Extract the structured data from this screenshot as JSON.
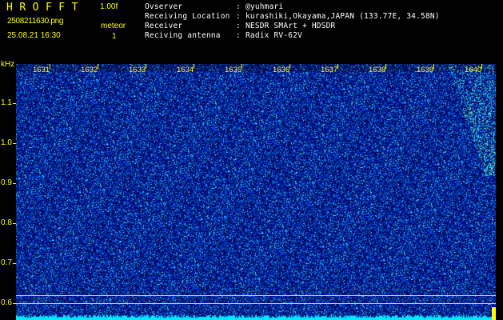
{
  "header": {
    "app_title": "HROFFT",
    "version": "1.00f",
    "filename": "2508211630.png",
    "datetime": "25.08.21 16:30",
    "meteor_label": "meteor",
    "meteor_count": "1"
  },
  "info": [
    {
      "label": "Ovserver",
      "sep": ":",
      "value": "@yuhmari"
    },
    {
      "label": "Receiving Location",
      "sep": ":",
      "value": "kurashiki,Okayama,JAPAN (133.77E, 34.58N)"
    },
    {
      "label": "Receiver",
      "sep": ":",
      "value": "NESDR SMArt + HDSDR"
    },
    {
      "label": "Reciving antenna",
      "sep": ":",
      "value": "Radix RV-62V"
    }
  ],
  "axis": {
    "unit": "kHz",
    "y_labels": [
      "1.1",
      "1.0",
      "0.9",
      "0.8",
      "0.7",
      "0.6"
    ],
    "y_values": [
      1.1,
      1.0,
      0.9,
      0.8,
      0.7,
      0.6
    ],
    "y_range": [
      0.575,
      1.2
    ],
    "time_labels": [
      "1631",
      "1632",
      "1633",
      "1634",
      "1635",
      "1636",
      "1637",
      "1638",
      "1639",
      "1640"
    ],
    "time_values": [
      1631,
      1632,
      1633,
      1634,
      1635,
      1636,
      1637,
      1638,
      1639,
      1640
    ],
    "time_range": [
      1630.5,
      1640.5
    ],
    "reference_lines_khz": [
      0.625,
      0.605
    ]
  },
  "colors": {
    "background": "#000000",
    "label_yellow": "#ffff00",
    "noise_dark": "#00106a",
    "noise_bright": "#2a6bff",
    "signal_cyan": "#00ffff",
    "signal_green": "#c8ff64",
    "baseline_cyan": "#00e8ff"
  }
}
